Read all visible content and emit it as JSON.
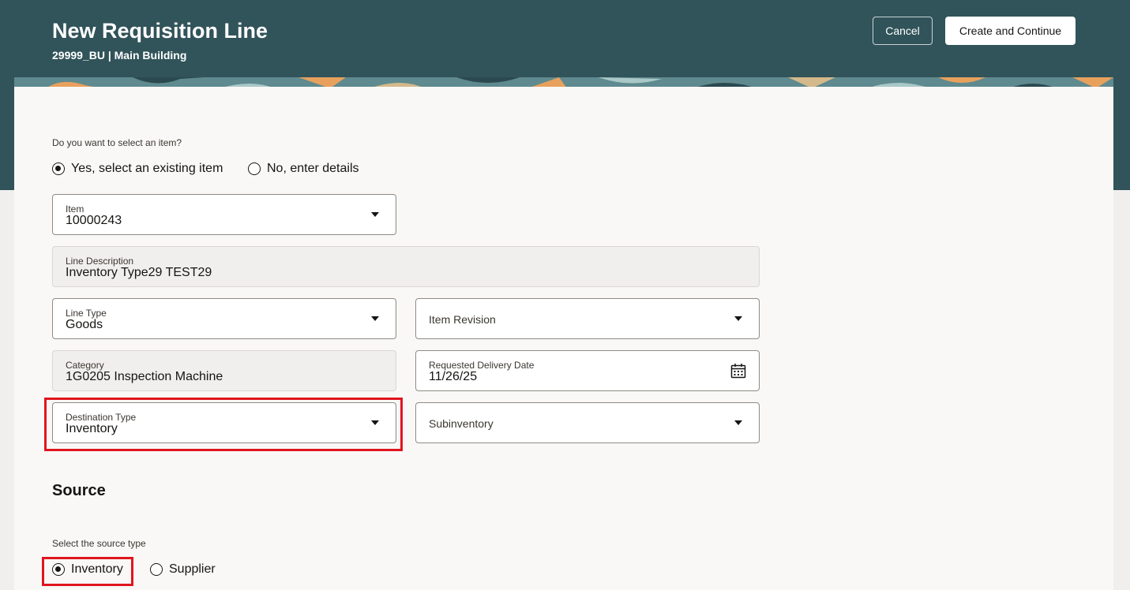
{
  "header": {
    "title": "New Requisition Line",
    "subtitle": "29999_BU | Main Building",
    "cancel_label": "Cancel",
    "create_label": "Create and Continue"
  },
  "item_selection": {
    "question": "Do you want to select an item?",
    "options": [
      "Yes, select an existing item",
      "No, enter details"
    ],
    "selected": "Yes, select an existing item"
  },
  "fields": {
    "item": {
      "label": "Item",
      "value": "10000243"
    },
    "line_description": {
      "label": "Line Description",
      "value": "Inventory Type29 TEST29"
    },
    "line_type": {
      "label": "Line Type",
      "value": "Goods"
    },
    "item_revision": {
      "label": "Item Revision"
    },
    "category": {
      "label": "Category",
      "value": "1G0205 Inspection Machine"
    },
    "requested_delivery_date": {
      "label": "Requested Delivery Date",
      "value": "11/26/25"
    },
    "destination_type": {
      "label": "Destination Type",
      "value": "Inventory"
    },
    "subinventory": {
      "label": "Subinventory"
    }
  },
  "source": {
    "title": "Source",
    "question": "Select the source type",
    "options": [
      "Inventory",
      "Supplier"
    ],
    "selected": "Inventory"
  },
  "colors": {
    "header_bg": "#31535a",
    "highlight": "#e0151f",
    "panel_bg": "#f9f8f6"
  },
  "icons": [
    "caret-down-icon",
    "calendar-icon"
  ]
}
